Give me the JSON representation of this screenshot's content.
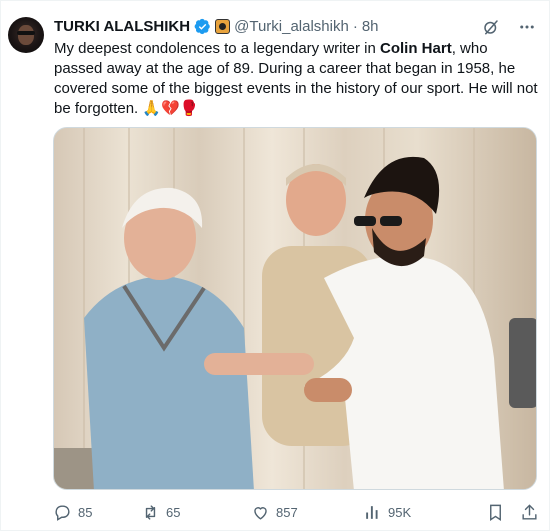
{
  "author": {
    "name": "TURKI ALALSHIKH",
    "handle": "@Turki_alalshikh",
    "separator": "·",
    "time": "8h"
  },
  "tweet": {
    "text_part1": "My deepest condolences to a legendary writer in ",
    "highlight": "Colin Hart",
    "text_part2": ", who passed away at the age of 89. During a career that began in 1958, he covered some of the biggest events in the history of our sport. He will not be forgotten. ",
    "emojis": "🙏💔🥊"
  },
  "actions": {
    "replies": "85",
    "reposts": "65",
    "likes": "857",
    "views": "95K"
  },
  "colors": {
    "text": "#0f1419",
    "secondary": "#536471",
    "verified": "#1d9bf0",
    "affiliation": "#e8a33d"
  },
  "icons": [
    "verified-badge-icon",
    "affiliation-badge-icon",
    "grok-icon",
    "more-icon",
    "reply-icon",
    "repost-icon",
    "like-icon",
    "views-icon",
    "bookmark-icon",
    "share-icon"
  ]
}
